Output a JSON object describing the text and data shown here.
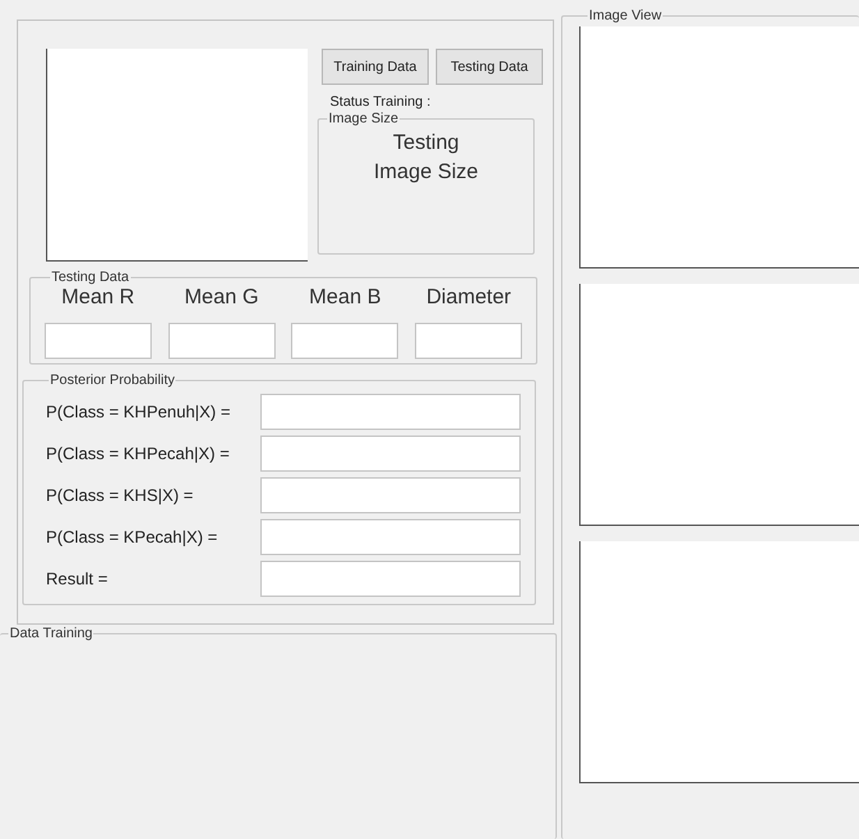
{
  "main_panel": {
    "buttons": [
      "Training Data",
      "Testing Data"
    ],
    "status_training": "Status Training :",
    "image_size": {
      "title": "Image Size",
      "lines": [
        "Testing",
        "Image Size"
      ]
    }
  },
  "testing_data": {
    "title": "Testing Data",
    "columns": [
      {
        "label": "Mean R"
      },
      {
        "label": "Mean G"
      },
      {
        "label": "Mean B"
      },
      {
        "label": "Diameter"
      }
    ]
  },
  "posterior_probability": {
    "title": "Posterior Probability",
    "rows": [
      {
        "label": "P(Class = KHPenuh|X) ="
      },
      {
        "label": "P(Class = KHPecah|X) ="
      },
      {
        "label": "P(Class = KHS|X) ="
      },
      {
        "label": "P(Class = KPecah|X) ="
      },
      {
        "label": "Result ="
      }
    ]
  },
  "data_training": {
    "title": "Data Training"
  },
  "image_view": {
    "title": "Image View"
  }
}
